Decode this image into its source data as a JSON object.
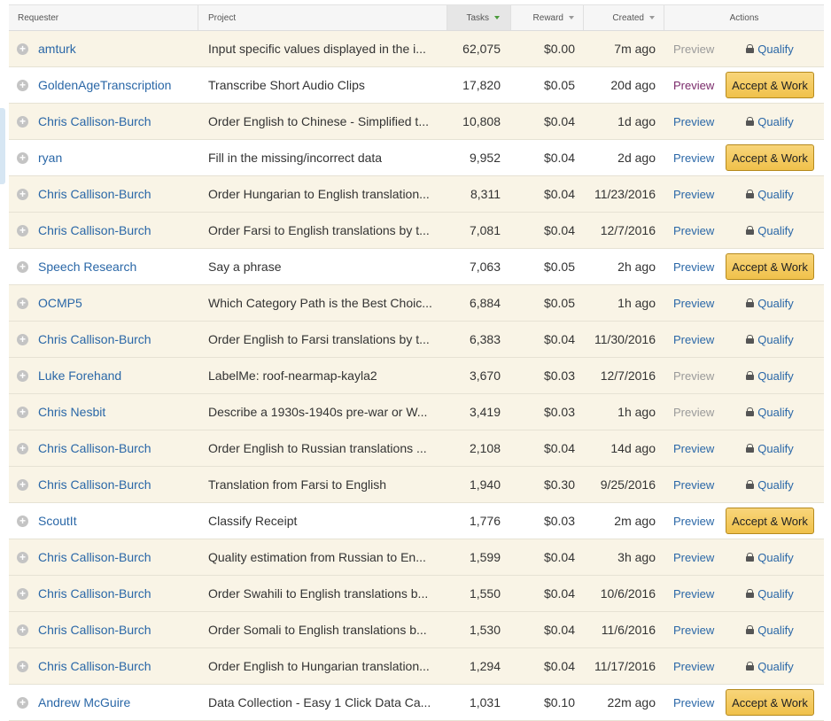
{
  "table": {
    "headers": {
      "requester": "Requester",
      "project": "Project",
      "tasks": "Tasks",
      "reward": "Reward",
      "created": "Created",
      "actions": "Actions"
    },
    "rows": [
      {
        "requester": "amturk",
        "project": "Input specific values displayed in the i...",
        "tasks": "62,075",
        "reward": "$0.00",
        "created": "7m ago",
        "preview": "Preview",
        "action": "Qualify"
      },
      {
        "requester": "GoldenAgeTranscription",
        "project": "Transcribe Short Audio Clips",
        "tasks": "17,820",
        "reward": "$0.05",
        "created": "20d ago",
        "preview": "Preview",
        "action": "Accept & Work"
      },
      {
        "requester": "Chris Callison-Burch",
        "project": "Order English to Chinese - Simplified t...",
        "tasks": "10,808",
        "reward": "$0.04",
        "created": "1d ago",
        "preview": "Preview",
        "action": "Qualify"
      },
      {
        "requester": "ryan",
        "project": "Fill in the missing/incorrect data",
        "tasks": "9,952",
        "reward": "$0.04",
        "created": "2d ago",
        "preview": "Preview",
        "action": "Accept & Work"
      },
      {
        "requester": "Chris Callison-Burch",
        "project": "Order Hungarian to English translation...",
        "tasks": "8,311",
        "reward": "$0.04",
        "created": "11/23/2016",
        "preview": "Preview",
        "action": "Qualify"
      },
      {
        "requester": "Chris Callison-Burch",
        "project": "Order Farsi to English translations by t...",
        "tasks": "7,081",
        "reward": "$0.04",
        "created": "12/7/2016",
        "preview": "Preview",
        "action": "Qualify"
      },
      {
        "requester": "Speech Research",
        "project": "Say a phrase",
        "tasks": "7,063",
        "reward": "$0.05",
        "created": "2h ago",
        "preview": "Preview",
        "action": "Accept & Work"
      },
      {
        "requester": "OCMP5",
        "project": "Which Category Path is the Best Choic...",
        "tasks": "6,884",
        "reward": "$0.05",
        "created": "1h ago",
        "preview": "Preview",
        "action": "Qualify"
      },
      {
        "requester": "Chris Callison-Burch",
        "project": "Order English to Farsi translations by t...",
        "tasks": "6,383",
        "reward": "$0.04",
        "created": "11/30/2016",
        "preview": "Preview",
        "action": "Qualify"
      },
      {
        "requester": "Luke Forehand",
        "project": "LabelMe: roof-nearmap-kayla2",
        "tasks": "3,670",
        "reward": "$0.03",
        "created": "12/7/2016",
        "preview": "Preview",
        "action": "Qualify"
      },
      {
        "requester": "Chris Nesbit",
        "project": "Describe a 1930s-1940s pre-war or W...",
        "tasks": "3,419",
        "reward": "$0.03",
        "created": "1h ago",
        "preview": "Preview",
        "action": "Qualify"
      },
      {
        "requester": "Chris Callison-Burch",
        "project": "Order English to Russian translations ...",
        "tasks": "2,108",
        "reward": "$0.04",
        "created": "14d ago",
        "preview": "Preview",
        "action": "Qualify"
      },
      {
        "requester": "Chris Callison-Burch",
        "project": "Translation from Farsi to English",
        "tasks": "1,940",
        "reward": "$0.30",
        "created": "9/25/2016",
        "preview": "Preview",
        "action": "Qualify"
      },
      {
        "requester": "ScoutIt",
        "project": "Classify Receipt",
        "tasks": "1,776",
        "reward": "$0.03",
        "created": "2m ago",
        "preview": "Preview",
        "action": "Accept & Work"
      },
      {
        "requester": "Chris Callison-Burch",
        "project": "Quality estimation from Russian to En...",
        "tasks": "1,599",
        "reward": "$0.04",
        "created": "3h ago",
        "preview": "Preview",
        "action": "Qualify"
      },
      {
        "requester": "Chris Callison-Burch",
        "project": "Order Swahili to English translations b...",
        "tasks": "1,550",
        "reward": "$0.04",
        "created": "10/6/2016",
        "preview": "Preview",
        "action": "Qualify"
      },
      {
        "requester": "Chris Callison-Burch",
        "project": "Order Somali to English translations b...",
        "tasks": "1,530",
        "reward": "$0.04",
        "created": "11/6/2016",
        "preview": "Preview",
        "action": "Qualify"
      },
      {
        "requester": "Chris Callison-Burch",
        "project": "Order English to Hungarian translation...",
        "tasks": "1,294",
        "reward": "$0.04",
        "created": "11/17/2016",
        "preview": "Preview",
        "action": "Qualify"
      },
      {
        "requester": "Andrew McGuire",
        "project": "Data Collection - Easy 1 Click Data Ca...",
        "tasks": "1,031",
        "reward": "$0.10",
        "created": "22m ago",
        "preview": "Preview",
        "action": "Accept & Work"
      }
    ]
  }
}
